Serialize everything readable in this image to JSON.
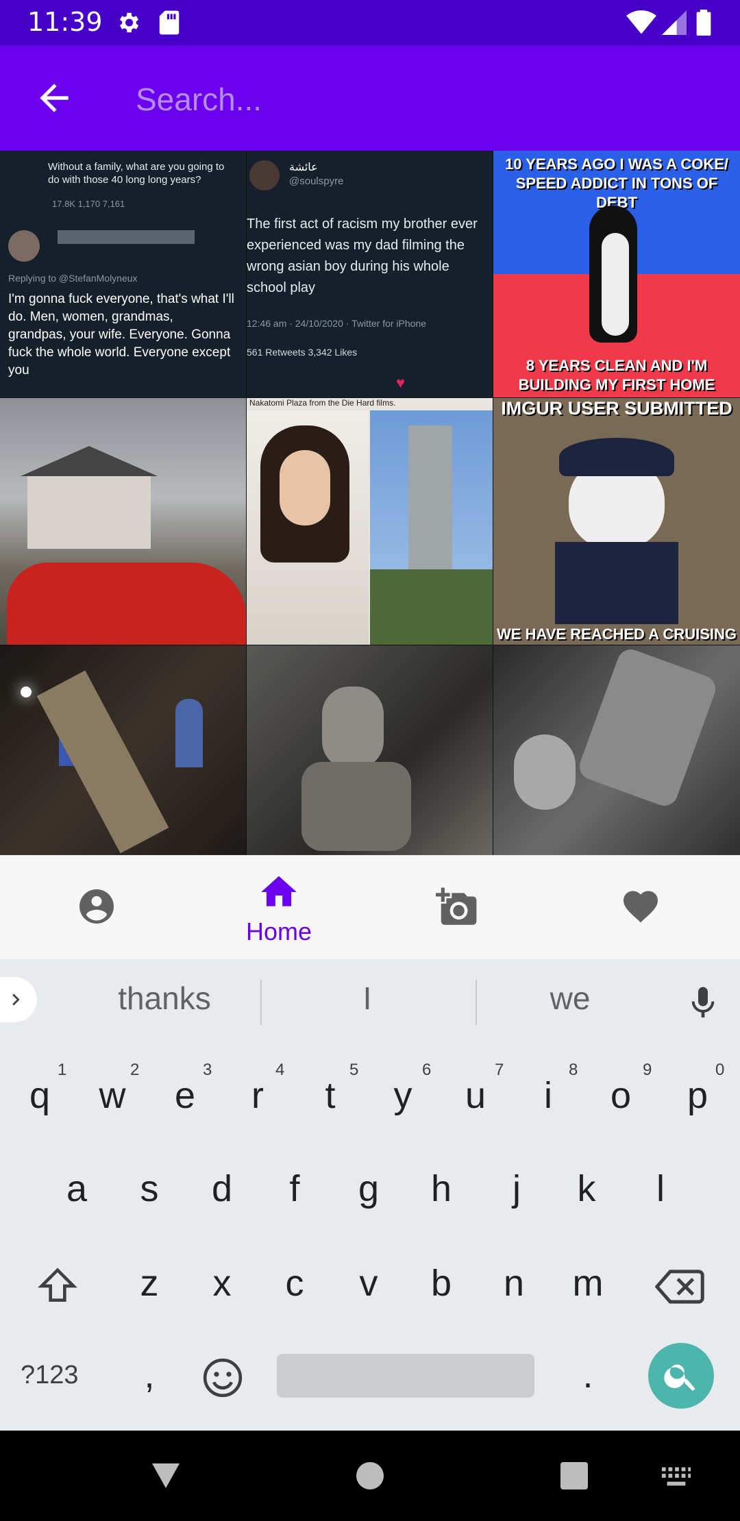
{
  "status": {
    "time": "11:39"
  },
  "search": {
    "placeholder": "Search..."
  },
  "tiles": {
    "t1_tweet_reply": "Replying to @StefanMolyneux",
    "t1_tweet_text": "I'm gonna fuck everyone, that's what I'll do. Men, women, grandmas, grandpas, your wife. Everyone. Gonna fuck the whole world. Everyone except you",
    "t1_top_text": "Without a family, what are you going to do with those 40 long long years?",
    "t1_stats": "17.8K   1,170   7,161",
    "t2_name": "عائشة",
    "t2_handle": "@soulspyre",
    "t2_text": "The first act of racism my brother ever experienced was my dad filming the wrong asian boy during his whole school play",
    "t2_meta": "12:46 am · 24/10/2020 · Twitter for iPhone",
    "t2_counts": "561 Retweets  3,342 Likes",
    "t3_top": "10 YEARS AGO I WAS A COKE/ SPEED ADDICT IN TONS OF DEBT",
    "t3_bottom": "8 YEARS CLEAN AND I'M BUILDING MY FIRST HOME",
    "t5_caption": "Nakatomi Plaza from the Die Hard films.",
    "t6_top": "IMGUR USER SUBMITTED",
    "t6_bottom": "WE HAVE REACHED A CRUISING"
  },
  "nav": {
    "home_label": "Home"
  },
  "suggestions": [
    "thanks",
    "I",
    "we"
  ],
  "keyboard": {
    "row1": [
      "q",
      "w",
      "e",
      "r",
      "t",
      "y",
      "u",
      "i",
      "o",
      "p"
    ],
    "row1_sup": [
      "1",
      "2",
      "3",
      "4",
      "5",
      "6",
      "7",
      "8",
      "9",
      "0"
    ],
    "row2": [
      "a",
      "s",
      "d",
      "f",
      "g",
      "h",
      "j",
      "k",
      "l"
    ],
    "row3": [
      "z",
      "x",
      "c",
      "v",
      "b",
      "n",
      "m"
    ],
    "symbols": "?123",
    "comma": ",",
    "period": "."
  },
  "colors": {
    "accent": "#6A00EE",
    "status_bar": "#4600C8",
    "search_key": "#4DB6AC"
  }
}
